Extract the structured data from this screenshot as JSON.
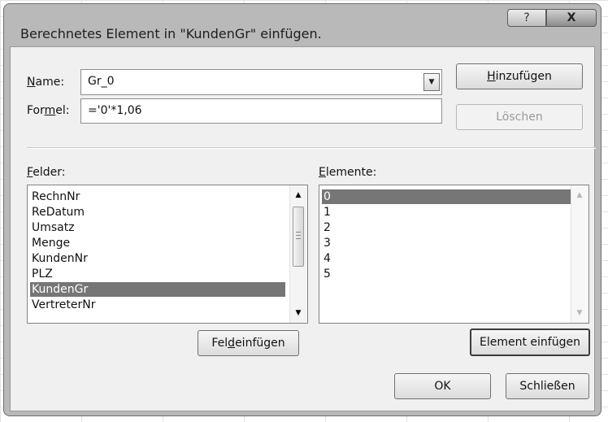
{
  "dialog": {
    "title": "Berechnetes Element in \"KundenGr\" einfügen.",
    "help_glyph": "?",
    "close_glyph": "X"
  },
  "name_field": {
    "label_mnemonic": "N",
    "label_rest": "ame:",
    "value": "Gr_0",
    "dropdown_glyph": "▼"
  },
  "formula_field": {
    "label_pre": "For",
    "label_mnemonic": "m",
    "label_post": "el:",
    "value": "='0'*1,06"
  },
  "buttons": {
    "add": {
      "mnemonic": "H",
      "rest": "inzufügen"
    },
    "delete": {
      "label": "Löschen"
    },
    "insert_field": {
      "pre": "Fel",
      "mnemonic": "d",
      "post": " einfügen"
    },
    "insert_element": {
      "pre": "Element einfü",
      "mnemonic": "g",
      "post": "en"
    },
    "ok": {
      "label": "OK"
    },
    "close": {
      "label": "Schließen"
    }
  },
  "fields": {
    "label_mnemonic": "F",
    "label_rest": "elder:",
    "items": [
      "RechnNr",
      "ReDatum",
      "Umsatz",
      "Menge",
      "KundenNr",
      "PLZ",
      "KundenGr",
      "VertreterNr"
    ],
    "selected": "KundenGr"
  },
  "elements": {
    "label_mnemonic": "E",
    "label_rest": "lemente:",
    "items": [
      "0",
      "1",
      "2",
      "3",
      "4",
      "5"
    ],
    "selected": "0"
  },
  "scrollbar": {
    "up_glyph": "▲",
    "down_glyph": "▼"
  }
}
